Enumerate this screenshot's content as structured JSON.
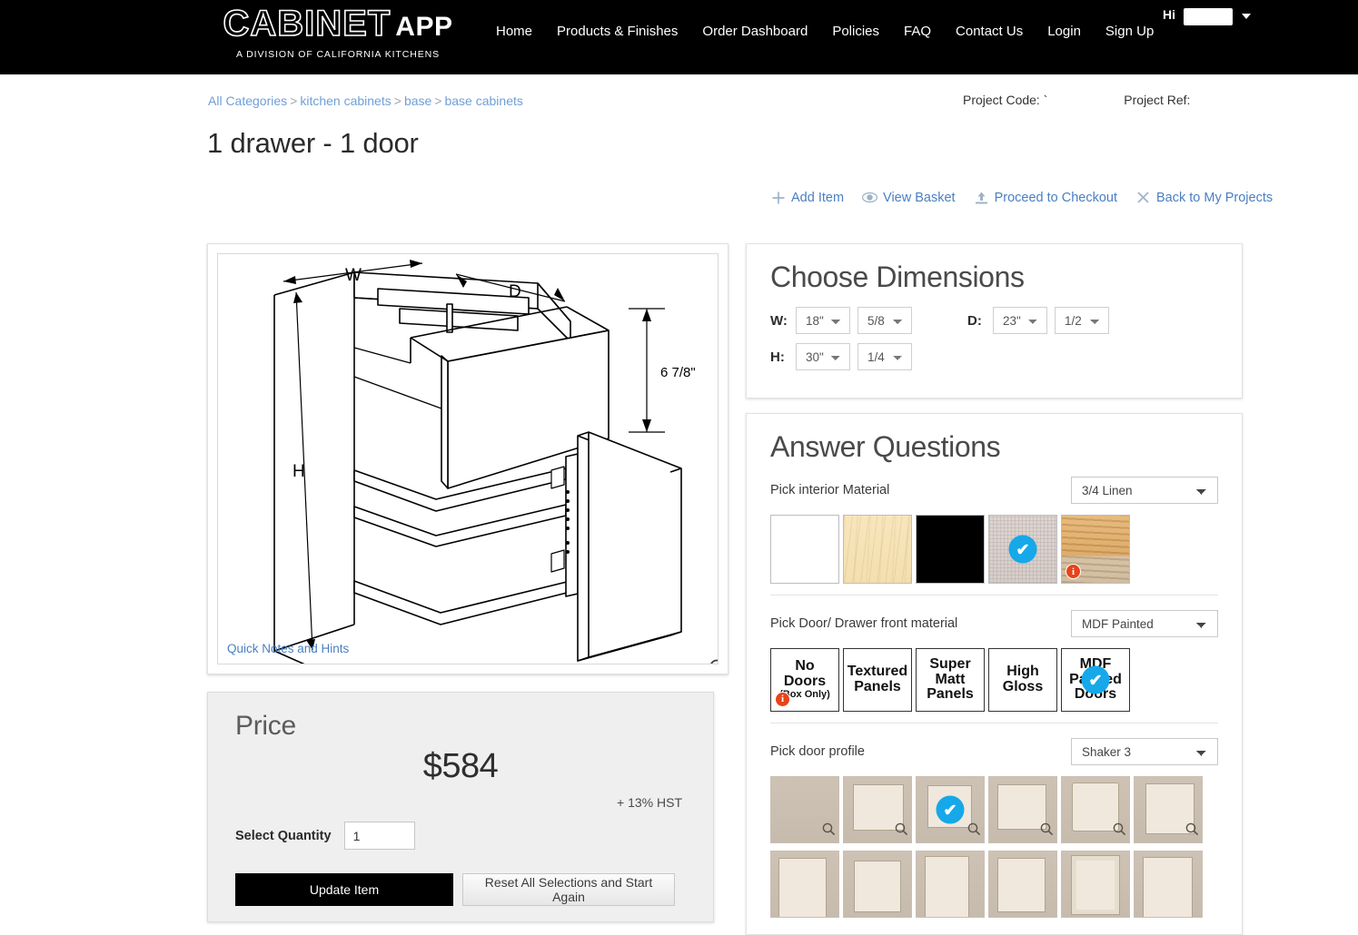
{
  "header": {
    "logo": {
      "main": "CABINET",
      "accent": "APP",
      "tagline": "A DIVISION OF CALIFORNIA KITCHENS"
    },
    "nav": [
      {
        "label": "Home"
      },
      {
        "label": "Products & Finishes"
      },
      {
        "label": "Order Dashboard"
      },
      {
        "label": "Policies"
      },
      {
        "label": "FAQ"
      },
      {
        "label": "Contact Us"
      },
      {
        "label": "Login"
      },
      {
        "label": "Sign Up"
      }
    ],
    "greeting": "Hi"
  },
  "breadcrumb": {
    "items": [
      "All Categories",
      "kitchen cabinets",
      "base",
      "base cabinets"
    ],
    "separator": ">"
  },
  "page_title": "1 drawer - 1 door",
  "project": {
    "code_label": "Project Code:",
    "code_value": "`",
    "ref_label": "Project Ref:",
    "ref_value": ""
  },
  "toolbar": {
    "add_item": "Add Item",
    "view_basket": "View Basket",
    "checkout": "Proceed to Checkout",
    "back_projects": "Back to My Projects"
  },
  "drawing": {
    "label_w": "W",
    "label_d": "D",
    "label_h": "H",
    "drawer_height": "6 7/8\"",
    "quick_notes": "Quick Notes and Hints"
  },
  "price": {
    "title": "Price",
    "amount": "$584",
    "tax_note": "+ 13% HST",
    "qty_label": "Select Quantity",
    "qty_value": "1",
    "update_label": "Update Item",
    "reset_label": "Reset All Selections and Start Again"
  },
  "dimensions": {
    "title": "Choose Dimensions",
    "w_label": "W:",
    "w_whole": "18\"",
    "w_frac": "5/8",
    "d_label": "D:",
    "d_whole": "23\"",
    "d_frac": "1/2",
    "h_label": "H:",
    "h_whole": "30\"",
    "h_frac": "1/4"
  },
  "questions": {
    "title": "Answer Questions",
    "interior": {
      "label": "Pick interior Material",
      "selected": "3/4 Linen",
      "swatches": [
        {
          "name": "white",
          "selected": false,
          "info": false
        },
        {
          "name": "maple",
          "selected": false,
          "info": false
        },
        {
          "name": "black",
          "selected": false,
          "info": false
        },
        {
          "name": "linen",
          "selected": true,
          "info": false
        },
        {
          "name": "plywood",
          "selected": false,
          "info": true
        }
      ]
    },
    "door_material": {
      "label": "Pick Door/ Drawer front material",
      "selected": "MDF Painted",
      "options": [
        {
          "line1": "No",
          "line2": "Doors",
          "line3": "(Box Only)",
          "selected": false,
          "info": true
        },
        {
          "line1": "Textured",
          "line2": "Panels",
          "line3": "",
          "selected": false,
          "info": false
        },
        {
          "line1": "Super",
          "line2": "Matt",
          "line3": "Panels",
          "selected": false,
          "info": false
        },
        {
          "line1": "High",
          "line2": "Gloss",
          "line3": "",
          "selected": false,
          "info": false
        },
        {
          "line1": "MDF",
          "line2": "Painted",
          "line3": "Doors",
          "selected": true,
          "info": false
        }
      ]
    },
    "door_profile": {
      "label": "Pick door profile",
      "selected": "Shaker 3",
      "thumbs": [
        {
          "id": 1,
          "selected": false
        },
        {
          "id": 2,
          "selected": false
        },
        {
          "id": 3,
          "selected": true
        },
        {
          "id": 4,
          "selected": false
        },
        {
          "id": 5,
          "selected": false
        },
        {
          "id": 6,
          "selected": false
        },
        {
          "id": 7,
          "selected": false
        },
        {
          "id": 8,
          "selected": false
        },
        {
          "id": 9,
          "selected": false
        },
        {
          "id": 10,
          "selected": false
        },
        {
          "id": 11,
          "selected": false
        },
        {
          "id": 12,
          "selected": false
        }
      ]
    }
  },
  "icons": {
    "check": "✔",
    "info": "i",
    "magnifier": "⌕"
  },
  "colors": {
    "accent_blue": "#4a7fc1",
    "check_blue": "#16a8e8",
    "info_red": "#e8431a",
    "header_bg": "#000000"
  }
}
